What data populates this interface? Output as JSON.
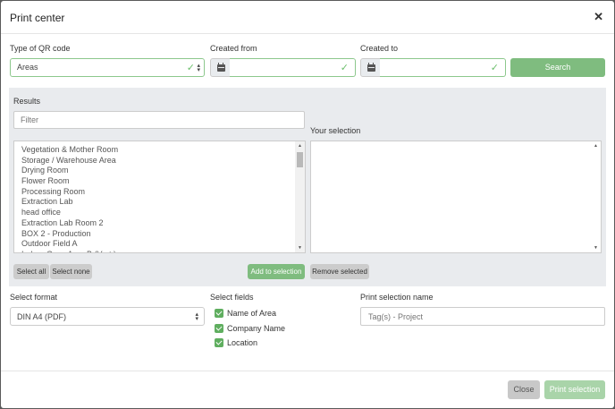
{
  "modal": {
    "title": "Print center"
  },
  "filters": {
    "type_label": "Type of QR code",
    "type_value": "Areas",
    "created_from_label": "Created from",
    "created_from_value": "",
    "created_to_label": "Created to",
    "created_to_value": "",
    "search_label": "Search"
  },
  "results": {
    "label": "Results",
    "filter_placeholder": "Filter",
    "items": [
      "Vegetation & Mother Room",
      "Storage / Warehouse Area",
      "Drying Room",
      "Flower Room",
      "Processing Room",
      "Extraction Lab",
      "head office",
      "Extraction Lab Room 2",
      "BOX 2 - Production",
      "Outdoor Field A",
      "Indoor Grow Area B (Vert.)"
    ],
    "select_all_label": "Select all",
    "select_none_label": "Select none",
    "add_label": "Add to selection"
  },
  "selection": {
    "label": "Your selection",
    "remove_label": "Remove selected"
  },
  "format": {
    "label": "Select format",
    "value": "DIN A4 (PDF)"
  },
  "fields": {
    "label": "Select fields",
    "items": [
      "Name of Area",
      "Company Name",
      "Location"
    ]
  },
  "print_name": {
    "label": "Print selection name",
    "placeholder": "Tag(s) - Project"
  },
  "footer": {
    "close_label": "Close",
    "print_label": "Print selection"
  },
  "colors": {
    "accent_green": "#7fbc7f",
    "panel_bg": "#e9ebee",
    "checkbox_green": "#5fae5f"
  }
}
